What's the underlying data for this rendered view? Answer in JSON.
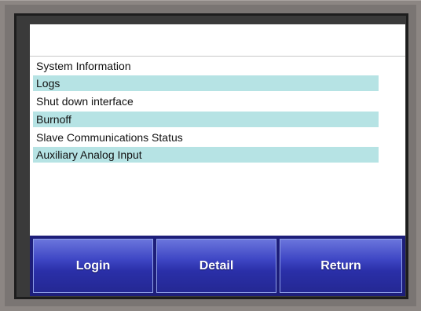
{
  "header": {
    "title": ""
  },
  "menu": {
    "items": [
      {
        "label": "System Information"
      },
      {
        "label": "Logs"
      },
      {
        "label": "Shut down interface"
      },
      {
        "label": "Burnoff"
      },
      {
        "label": "Slave Communications Status"
      },
      {
        "label": "Auxiliary Analog Input"
      }
    ]
  },
  "buttons": {
    "login_label": "Login",
    "detail_label": "Detail",
    "return_label": "Return"
  },
  "colors": {
    "bezel": "#8c8683",
    "alt_row": "#b6e3e4",
    "button_bar": "#1d1e7a",
    "button_face": "#3e46c4"
  }
}
